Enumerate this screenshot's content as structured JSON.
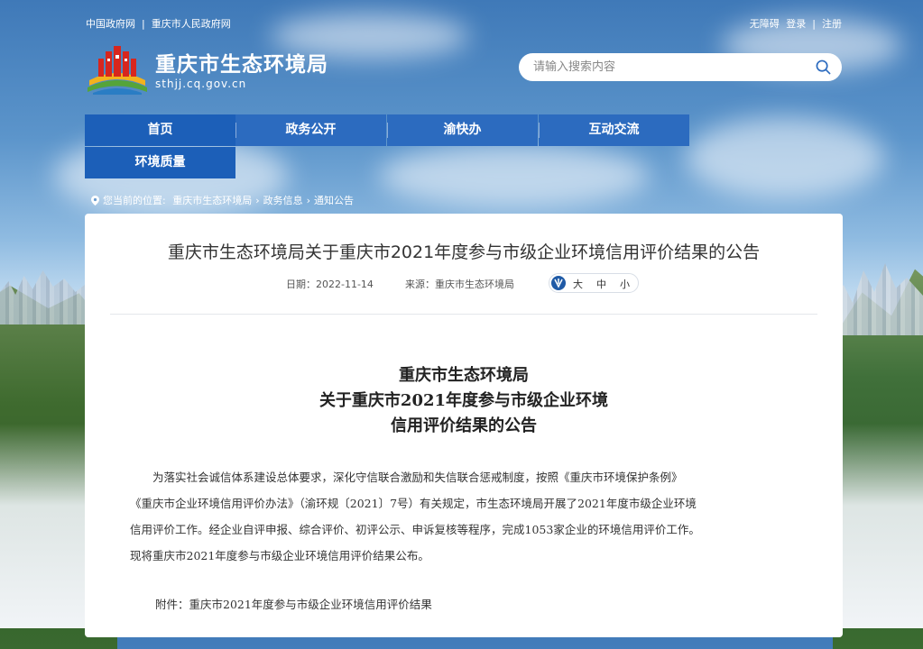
{
  "top_links": {
    "left": [
      "中国政府网",
      "重庆市人民政府网"
    ],
    "right": [
      "无障碍",
      "登录",
      "注册"
    ]
  },
  "site": {
    "title": "重庆市生态环境局",
    "url": "sthjj.cq.gov.cn"
  },
  "search": {
    "placeholder": "请输入搜索内容"
  },
  "nav": {
    "items": [
      "首页",
      "政务公开",
      "渝快办",
      "互动交流",
      "环境质量"
    ]
  },
  "breadcrumb": {
    "prefix": "您当前的位置:",
    "items": [
      "重庆市生态环境局",
      "政务信息",
      "通知公告"
    ],
    "separator": "›"
  },
  "article": {
    "title": "重庆市生态环境局关于重庆市2021年度参与市级企业环境信用评价结果的公告",
    "date": "日期：2022-11-14",
    "source": "来源：重庆市生态环境局",
    "font_sizes": [
      "大",
      "中",
      "小"
    ],
    "doc_title_lines": [
      "重庆市生态环境局",
      "关于重庆市2021年度参与市级企业环境",
      "信用评价结果的公告"
    ],
    "body_lines": [
      "为落实社会诚信体系建设总体要求，深化守信联合激励和失信联合惩戒制度，按照《重庆市环境保护条例》",
      "《重庆市企业环境信用评价办法》（渝环规〔2021〕7号）有关规定，市生态环境局开展了2021年度市级企业环境",
      "信用评价工作。经企业自评申报、综合评价、初评公示、申诉复核等程序，完成1053家企业的环境信用评价工作。",
      "现将重庆市2021年度参与市级企业环境信用评价结果公布。"
    ],
    "attachment": "附件：重庆市2021年度参与市级企业环境信用评价结果"
  },
  "colors": {
    "nav_bg": "#2c6bbf",
    "nav_active": "#1c5fb8",
    "logo_red": "#d7261e"
  }
}
